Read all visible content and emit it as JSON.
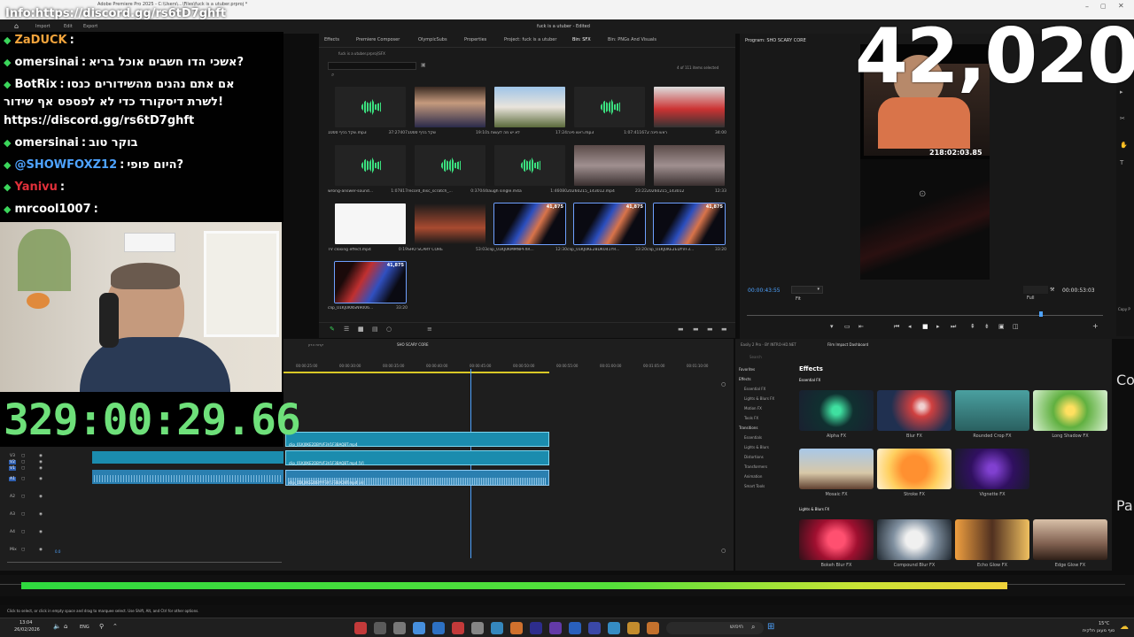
{
  "window": {
    "title": "fuck is a utuber - Edited",
    "title_left": "Adobe Premiere Pro 2025 - C:\\Users\\...\\Files\\fuck is a utuber.prproj *"
  },
  "menu": {
    "items": [
      "Import",
      "Edit",
      "Export"
    ]
  },
  "panels": {
    "tabs": [
      "Effects",
      "Premiere Composer",
      "OlympicSubs",
      "Properties",
      "Project: fuck is a utuber",
      "Bin: SFX",
      "Bin: PNGs And Visuals"
    ]
  },
  "project": {
    "path": "fuck is a utuber.prproj\\SFX",
    "count": "4 of 111 items selected",
    "items": [
      {
        "name": "1000 שקל בכיף.mp3",
        "dur": "37:27407",
        "kind": "audio"
      },
      {
        "name": "שקל בכיף 1000",
        "dur": "19:10",
        "kind": "face"
      },
      {
        "name": "לא יש מה לעשות ב",
        "dur": "17:24",
        "kind": "outdoor"
      },
      {
        "name": "ראש פינה.mp3",
        "dur": "1:07:41167",
        "kind": "audio"
      },
      {
        "name": "ראש פינה 2",
        "dur": "34:00",
        "kind": "man"
      },
      {
        "name": "wrong-answer-sound...",
        "dur": "1:07817",
        "kind": "audio"
      },
      {
        "name": "record_disc_scratch_...",
        "dur": "0:37044",
        "kind": "audio"
      },
      {
        "name": "laugh single.m4a",
        "dur": "1:46080",
        "kind": "audio"
      },
      {
        "name": "20260215_143012.mp4",
        "dur": "23:22",
        "kind": "photo"
      },
      {
        "name": "20260215_143012",
        "dur": "12:33",
        "kind": "photo"
      },
      {
        "name": "TV closing effect.mp4",
        "dur": "0:19",
        "kind": "white"
      },
      {
        "name": "SHO SCARY CORE",
        "dur": "53:03",
        "kind": "seq"
      },
      {
        "name": "clip_01KJ0KMMNPFXR...",
        "dur": "12:30",
        "kind": "stream",
        "badge": "41,875"
      },
      {
        "name": "clip_01KJ0KE28DK041YR...",
        "dur": "33:20",
        "kind": "stream",
        "badge": "41,875"
      },
      {
        "name": "clip_01KJ0KE2EDYVF3...",
        "dur": "33:20",
        "kind": "stream",
        "badge": "41,875"
      },
      {
        "name": "clip_01KJ0KNSN9006...",
        "dur": "33:20",
        "kind": "stream2",
        "badge": "41,875"
      }
    ]
  },
  "program": {
    "title": "Program: SHO SCARY CORE",
    "timecode": "00:00:43:55",
    "fit": "Fit",
    "quality": "Full",
    "duration": "00:00:53:03",
    "overlay_time": "218:02:03.85"
  },
  "timeline": {
    "tabs": [
      "קרוח הרון",
      "SHO SCARY CORE"
    ],
    "ruler": [
      "00:00:25:00",
      "00:00:30:00",
      "00:00:35:00",
      "00:00:40:00",
      "00:00:45:00",
      "00:00:50:00",
      "00:00:55:00",
      "00:01:00:00",
      "00:01:05:00",
      "00:01:10:00"
    ],
    "clip_v2": "clip_01KJ0KE2DBYVF3V1F3BAQBT.mp4",
    "clip_v1": "clip_01KJ0KE2DBYVF3V1F3BAQBT.mp4 [V]",
    "clip_a1": "clip_01KJ0KE2DBYVF3V1F3BAQBT.mp4 [A]",
    "track_labels": [
      "V3",
      "V2",
      "V1",
      "A1",
      "A2",
      "A3",
      "A4",
      "Mix"
    ],
    "mix_value": "0.0"
  },
  "effects": {
    "header_tabs": [
      "Easily 2 Pro - BY INTRO-HD.NET",
      "Film Impact Dashboard"
    ],
    "search": "Search",
    "title": "Effects",
    "categories": [
      "Favorites",
      "Effects",
      "Essential FX",
      "Lights & Blurs FX",
      "Motion FX",
      "Tools FX",
      "Transitions",
      "Essentials",
      "Lights & Blurs",
      "Distortions",
      "Transformers",
      "Animation",
      "Smart Tools"
    ],
    "section1": "Essential FX",
    "section2": "Lights & Blurs FX",
    "tiles": [
      "Alpha FX",
      "Blur FX",
      "Rounded Crop FX",
      "Long Shadow FX",
      "Mosaic FX",
      "Stroke FX",
      "Vignette FX"
    ],
    "tiles2": [
      "Bokeh Blur FX",
      "Compound Blur FX",
      "Echo Glow FX",
      "Edge Glow FX"
    ]
  },
  "chat": {
    "top_url": "Info:https://discord.gg/rs6tD7ghft",
    "lines": [
      {
        "user": "ZaDUCK",
        "sep": ":",
        "text": ""
      },
      {
        "user": "omersinai",
        "sep": ":",
        "text": "אשכי הדו חשבים אוכל בריא?"
      },
      {
        "user": "BotRix",
        "sep": ":",
        "text": "אם אתם נהנים מהשידורים כנסו"
      },
      {
        "user": "",
        "sep": "",
        "text": "לשרת דיסקורד כדי לא לפספס אף שידור!"
      },
      {
        "user": "",
        "sep": "",
        "text": "https://discord.gg/rs6tD7ghft"
      },
      {
        "user": "omersinai",
        "sep": ":",
        "text": "בוקר טוב"
      },
      {
        "user": "@SHOWFOXZ12",
        "sep": ":",
        "text": "היום פופי?"
      },
      {
        "user": "Yanivu",
        "sep": ":",
        "text": ""
      },
      {
        "user": "mrcool1007",
        "sep": ":",
        "text": ""
      }
    ],
    "colors": {
      "green": "#3bd65b",
      "red": "#e0303a",
      "blue": "#4ea3ff",
      "orange": "#f2a43c"
    }
  },
  "overlay": {
    "timer": "329:00:29.66",
    "counter": "42,020",
    "side1": "Co",
    "side2": "Pa",
    "copy": "Copy P"
  },
  "status": {
    "hint": "Click to select, or click in empty space and drag to marquee select. Use Shift, Alt, and Ctrl for other options."
  },
  "taskbar": {
    "time": "13:04",
    "date": "26/02/2026",
    "lang": "ENG",
    "search": "חיפוש",
    "weather": "סוף מעונן חלקית",
    "temp": "15°C"
  },
  "audio_level": 0.89
}
